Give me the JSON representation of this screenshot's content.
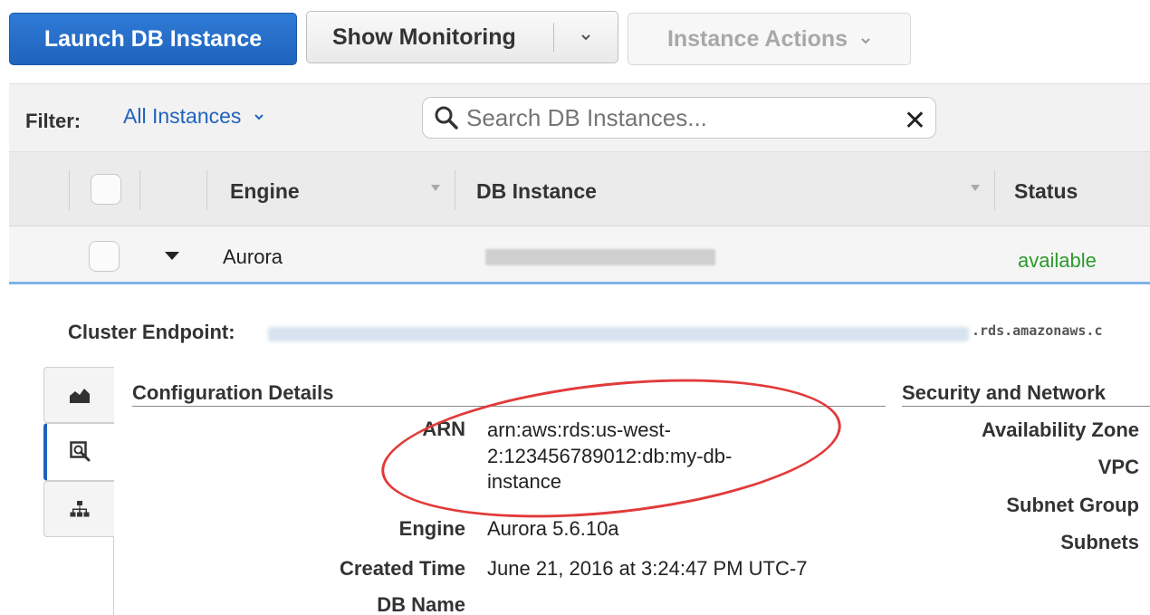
{
  "toolbar": {
    "launch_label": "Launch DB Instance",
    "monitoring_label": "Show Monitoring",
    "actions_label": "Instance Actions"
  },
  "filter": {
    "label": "Filter:",
    "selected": "All Instances",
    "search_placeholder": "Search DB Instances...",
    "clear_symbol": "✕"
  },
  "table": {
    "columns": [
      "Engine",
      "DB Instance",
      "Status"
    ],
    "row": {
      "engine": "Aurora",
      "status": "available",
      "status_color": "#2b9a2b"
    }
  },
  "detail": {
    "endpoint_label": "Cluster Endpoint:",
    "endpoint_suffix": ".rds.amazonaws.c",
    "tabs": [
      "monitoring-chart-icon",
      "details-magnifier-icon",
      "topology-tree-icon"
    ],
    "config": {
      "title": "Configuration Details",
      "arn_label": "ARN",
      "arn_value": "arn:aws:rds:us-west-2:123456789012:db:my-db-instance",
      "engine_label": "Engine",
      "engine_value": "Aurora 5.6.10a",
      "created_label": "Created Time",
      "created_value": "June 21, 2016 at 3:24:47 PM UTC-7",
      "dbname_label": "DB Name"
    },
    "security": {
      "title": "Security and Network",
      "labels": [
        "Availability Zone",
        "VPC",
        "Subnet Group",
        "Subnets"
      ]
    }
  },
  "colors": {
    "primary": "#1f63bd",
    "annotation": "#e23a3a"
  }
}
